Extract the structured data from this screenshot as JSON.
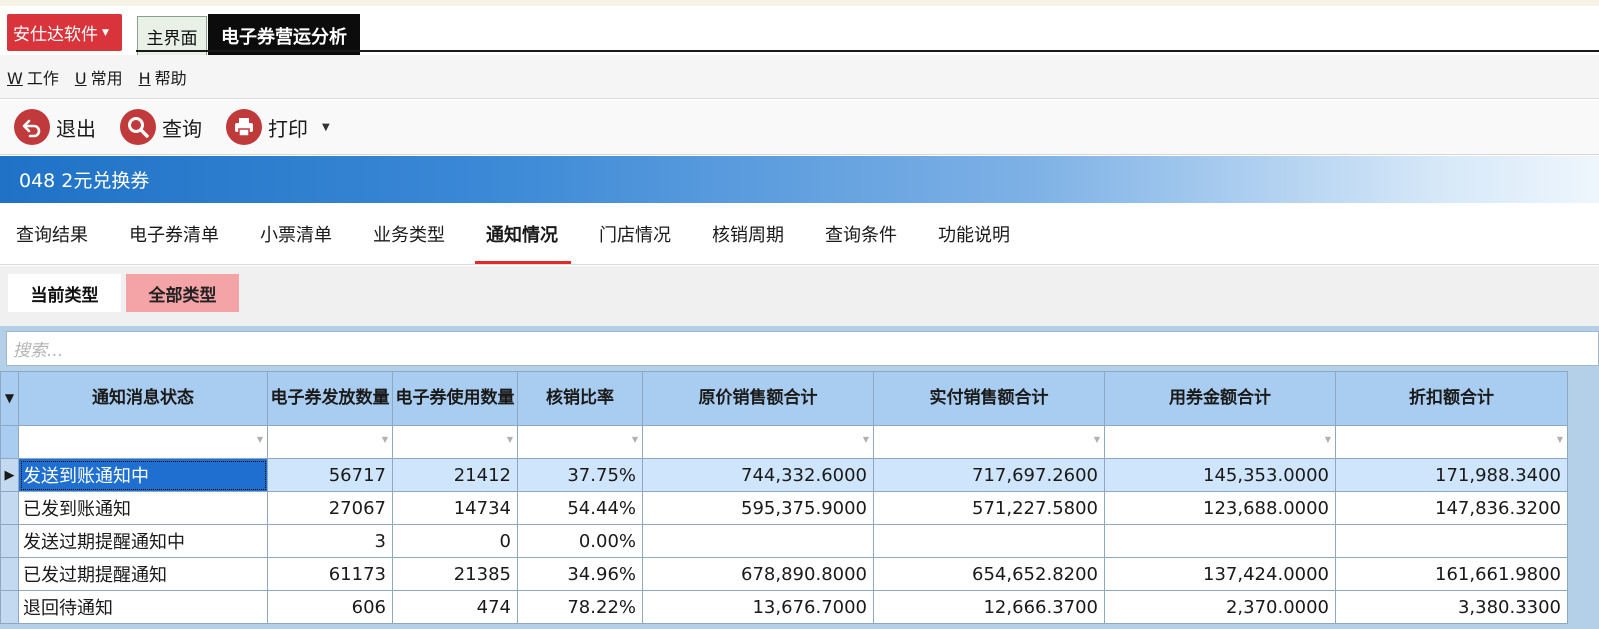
{
  "app": {
    "menu_button": "安仕达软件"
  },
  "window_tabs": [
    {
      "label": "主界面",
      "active": false
    },
    {
      "label": "电子券营运分析",
      "active": true
    }
  ],
  "menubar": [
    {
      "key": "W",
      "label": "工作"
    },
    {
      "key": "U",
      "label": "常用"
    },
    {
      "key": "H",
      "label": "帮助"
    }
  ],
  "toolbar": {
    "exit_label": "退出",
    "query_label": "查询",
    "print_label": "打印",
    "icon_color": "#c0393b"
  },
  "title_band": "048  2元兑换券",
  "tabs": [
    {
      "label": "查询结果"
    },
    {
      "label": "电子券清单"
    },
    {
      "label": "小票清单"
    },
    {
      "label": "业务类型"
    },
    {
      "label": "通知情况",
      "active": true
    },
    {
      "label": "门店情况"
    },
    {
      "label": "核销周期"
    },
    {
      "label": "查询条件"
    },
    {
      "label": "功能说明"
    }
  ],
  "type_toggle": {
    "current": "当前类型",
    "all": "全部类型"
  },
  "search": {
    "placeholder": "搜索..."
  },
  "grid": {
    "columns": [
      "通知消息状态",
      "电子券发放数量",
      "电子券使用数量",
      "核销比率",
      "原价销售额合计",
      "实付销售额合计",
      "用券金额合计",
      "折扣额合计"
    ],
    "rows": [
      [
        "发送到账通知中",
        "56717",
        "21412",
        "37.75%",
        "744,332.6000",
        "717,697.2600",
        "145,353.0000",
        "171,988.3400"
      ],
      [
        "已发到账通知",
        "27067",
        "14734",
        "54.44%",
        "595,375.9000",
        "571,227.5800",
        "123,688.0000",
        "147,836.3200"
      ],
      [
        "发送过期提醒通知中",
        "3",
        "0",
        "0.00%",
        "",
        "",
        "",
        ""
      ],
      [
        "已发过期提醒通知",
        "61173",
        "21385",
        "34.96%",
        "678,890.8000",
        "654,652.8200",
        "137,424.0000",
        "161,661.9800"
      ],
      [
        "退回待通知",
        "606",
        "474",
        "78.22%",
        "13,676.7000",
        "12,666.3700",
        "2,370.0000",
        "3,380.3300"
      ]
    ],
    "selected_row": 0
  },
  "colors": {
    "accent_red": "#d9343b",
    "header_blue": "#a9cdf0",
    "selection_blue": "#1f6fd1",
    "active_tab_underline": "#e02a2a"
  }
}
